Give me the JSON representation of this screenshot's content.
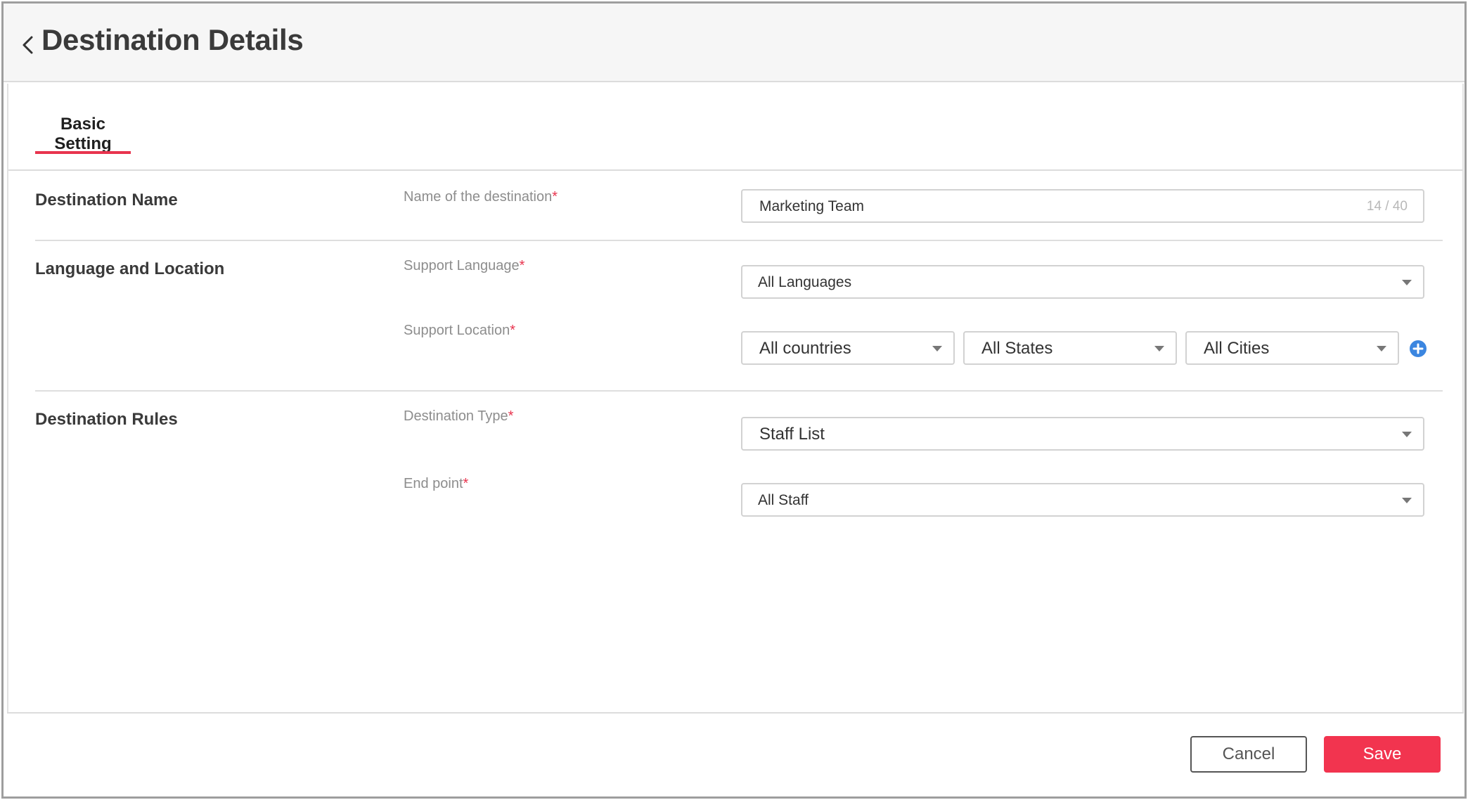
{
  "header": {
    "title": "Destination Details",
    "back_icon": "chevron-left-icon"
  },
  "tabs": [
    {
      "label": "Basic Setting",
      "active": true
    }
  ],
  "colors": {
    "accent": "#e8344e",
    "save_button": "#f2344f",
    "add_icon": "#3b86e0"
  },
  "sections": {
    "destination_name": {
      "title": "Destination Name",
      "field_label": "Name of the destination",
      "required_mark": "*",
      "value": "Marketing Team",
      "counter": "14 / 40"
    },
    "language_location": {
      "title": "Language and Location",
      "language_label": "Support Language",
      "language_value": "All Languages",
      "location_label": "Support Location",
      "country_value": "All countries",
      "state_value": "All States",
      "city_value": "All Cities",
      "add_icon": "plus-circle-icon"
    },
    "destination_rules": {
      "title": "Destination Rules",
      "type_label": "Destination Type",
      "type_value": "Staff List",
      "endpoint_label": "End point",
      "endpoint_value": "All Staff"
    }
  },
  "footer": {
    "cancel_label": "Cancel",
    "save_label": "Save"
  }
}
